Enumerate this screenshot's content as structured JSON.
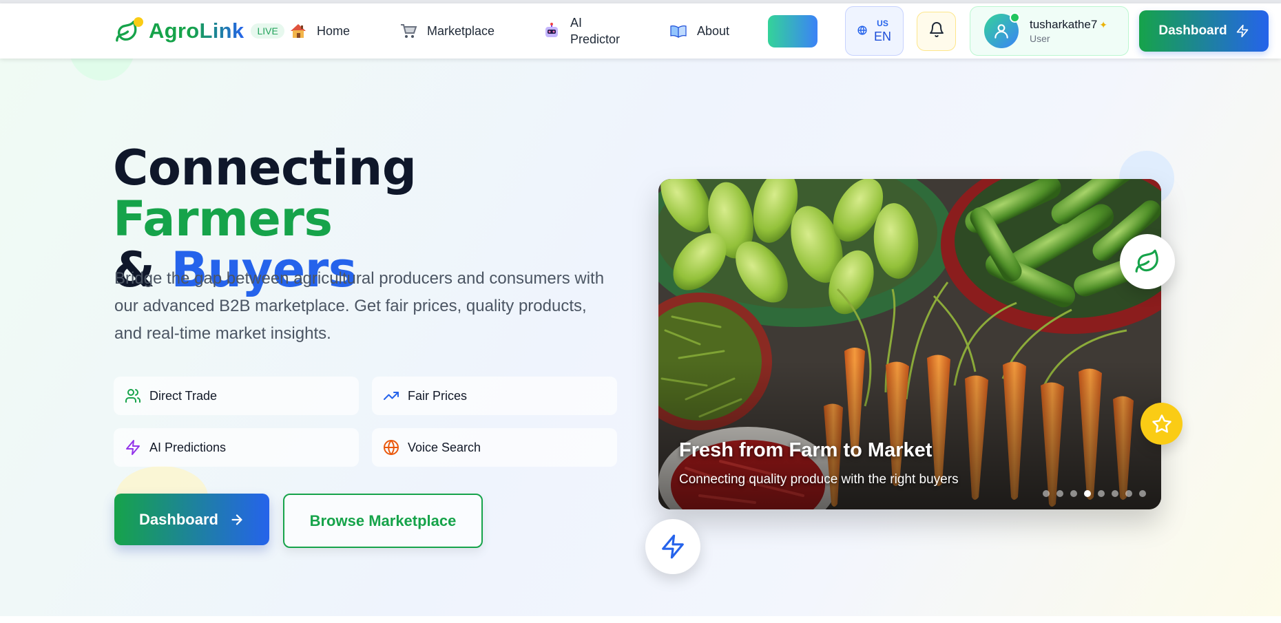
{
  "brand": {
    "name": "AgroLink",
    "badge": "LIVE",
    "colors": {
      "green": "#16a34a",
      "blue": "#2563eb",
      "yellow": "#facc15"
    }
  },
  "nav": {
    "items": [
      {
        "label": "Home",
        "icon": "house-icon"
      },
      {
        "label": "Marketplace",
        "icon": "shopping-cart-icon"
      },
      {
        "label": "AI Predictor",
        "icon": "robot-icon"
      },
      {
        "label": "About",
        "icon": "open-book-icon"
      }
    ],
    "language": {
      "country": "US",
      "code": "EN",
      "icon": "globe-icon"
    },
    "notifications_icon": "bell-icon",
    "user": {
      "name": "tusharkathe7",
      "role": "User",
      "icon": "user-icon"
    },
    "dashboard_label": "Dashboard"
  },
  "hero": {
    "headline": {
      "part1": "Connecting ",
      "highlight1": "Farmers",
      "part2": "& ",
      "highlight2": "Buyers"
    },
    "subtext": "Bridge the gap between agricultural producers and consumers with our advanced B2B marketplace. Get fair prices, quality products, and real-time market insights.",
    "features": [
      {
        "label": "Direct Trade",
        "icon": "users-icon",
        "color": "#16a34a"
      },
      {
        "label": "Fair Prices",
        "icon": "trending-up-icon",
        "color": "#2563eb"
      },
      {
        "label": "AI Predictions",
        "icon": "zap-icon",
        "color": "#9333ea"
      },
      {
        "label": "Voice Search",
        "icon": "globe-icon",
        "color": "#ea580c"
      }
    ],
    "primary_button": "Dashboard",
    "secondary_button": "Browse Marketplace"
  },
  "carousel": {
    "title": "Fresh from Farm to Market",
    "subtitle": "Connecting quality produce with the right buyers",
    "slide_count": 8,
    "active_index": 3
  }
}
